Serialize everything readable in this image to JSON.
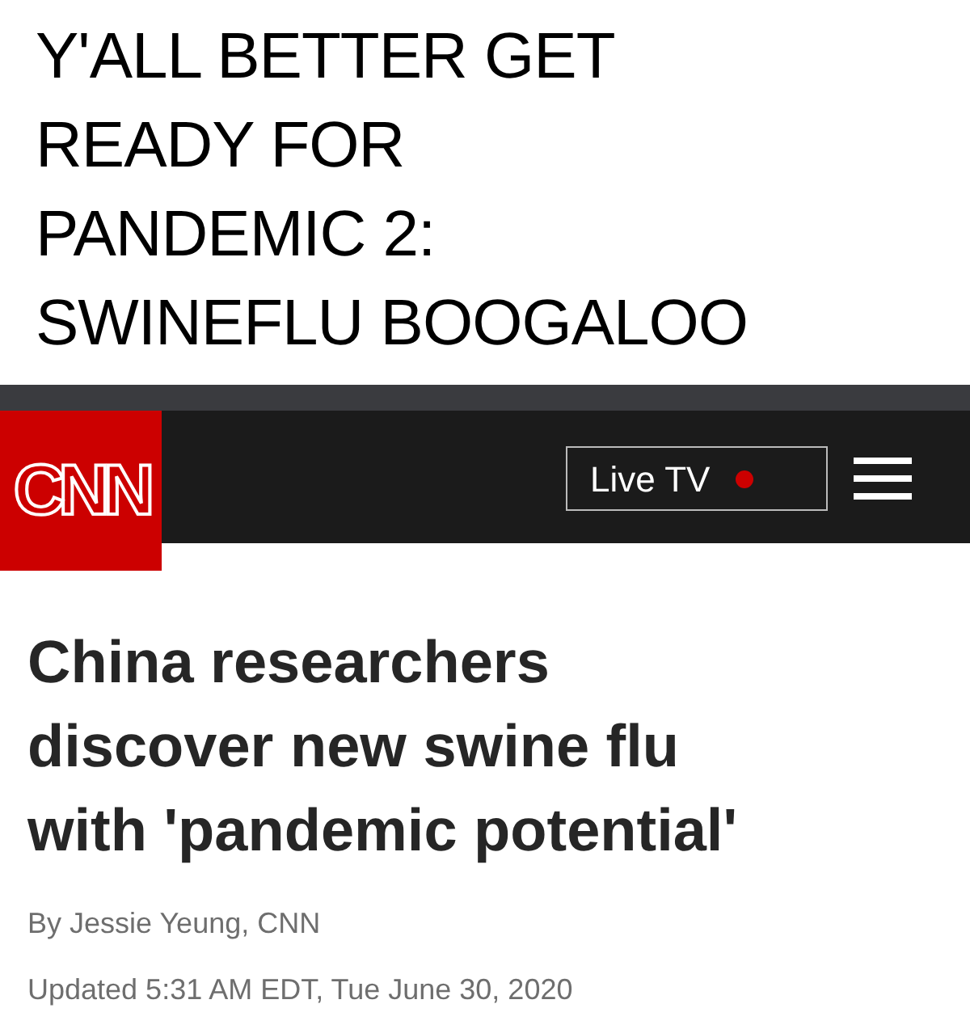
{
  "caption": "Y'ALL BETTER GET\nREADY FOR\nPANDEMIC 2:\nSWINEFLU BOOGALOO",
  "nav": {
    "logo": "CNN",
    "live_button": {
      "label": "Live TV",
      "live": true
    }
  },
  "article": {
    "headline": "China researchers discover new swine flu with 'pandemic potential'",
    "byline": "By Jessie Yeung, CNN",
    "updated": "Updated 5:31 AM EDT, Tue June 30, 2020"
  }
}
